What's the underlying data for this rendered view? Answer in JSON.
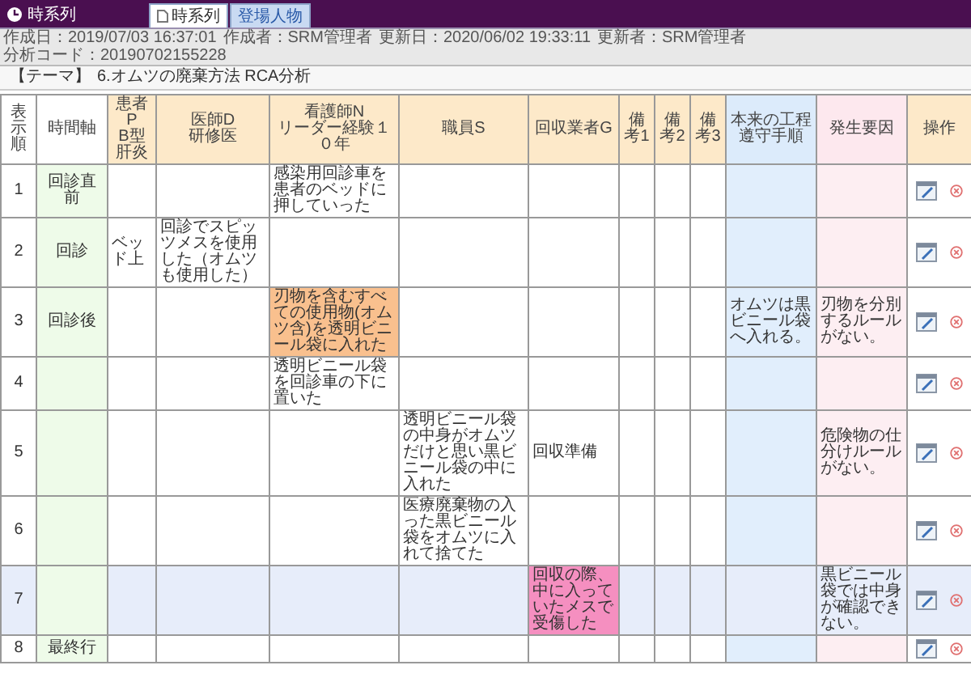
{
  "window": {
    "title": "時系列"
  },
  "tabs": [
    {
      "label": "時系列",
      "selected": true
    },
    {
      "label": "登場人物",
      "selected": false
    }
  ],
  "info": [
    "作成日：2019/07/03 16:37:01",
    "作成者：SRM管理者",
    "更新日：2020/06/02 19:33:11",
    "更新者：SRM管理者",
    "分析コード：20190702155228"
  ],
  "theme": {
    "label": "【テーマ】",
    "value": "6.オムツの廃棄方法 RCA分析"
  },
  "table": {
    "columns": [
      {
        "label": "表示順",
        "kind": "index"
      },
      {
        "label": "時間軸",
        "kind": "time"
      },
      {
        "label": "患者P\nB型肝炎",
        "kind": "person"
      },
      {
        "label": "医師D\n研修医",
        "kind": "person"
      },
      {
        "label": "看護師N\nリーダー経験１０年",
        "kind": "person"
      },
      {
        "label": "職員S",
        "kind": "person"
      },
      {
        "label": "回収業者G",
        "kind": "person"
      },
      {
        "label": "備考1",
        "kind": "note"
      },
      {
        "label": "備考2",
        "kind": "note"
      },
      {
        "label": "備考3",
        "kind": "note"
      },
      {
        "label": "本来の工程遵守手順",
        "kind": "standard"
      },
      {
        "label": "発生要因",
        "kind": "cause"
      },
      {
        "label": "操作",
        "kind": "action"
      }
    ],
    "rows": [
      {
        "order": "1",
        "time": "回診直前",
        "highlighted": false,
        "nurse": {
          "text": "感染用回診車を患者のベッドに押していった"
        }
      },
      {
        "order": "2",
        "time": "回診",
        "highlighted": false,
        "patient": {
          "text": "ベッド上"
        },
        "doctor": {
          "text": "回診でスピッツメスを使用した（オムツも使用した）"
        }
      },
      {
        "order": "3",
        "time": "回診後",
        "highlighted": false,
        "nurse": {
          "text": "刃物を含むすべての使用物(オムツ含)を透明ビニール袋に入れた",
          "color": "#f9c08e"
        },
        "standard": {
          "text": "オムツは黒ビニール袋へ入れる。"
        },
        "cause": {
          "text": "刃物を分別するルールがない。"
        }
      },
      {
        "order": "4",
        "highlighted": false,
        "nurse": {
          "text": "透明ビニール袋を回診車の下に置いた"
        }
      },
      {
        "order": "5",
        "highlighted": false,
        "staff": {
          "text": "透明ビニール袋の中身がオムツだけと思い黒ビニール袋の中に入れた"
        },
        "collector": {
          "text": "回収準備"
        },
        "cause": {
          "text": "危険物の仕分けルールがない。"
        }
      },
      {
        "order": "6",
        "highlighted": false,
        "staff": {
          "text": "医療廃棄物の入った黒ビニール袋をオムツに入れて捨てた"
        }
      },
      {
        "order": "7",
        "highlighted": true,
        "collector": {
          "text": "回収の際、中に入っていたメスで受傷した",
          "color": "#f58fc0"
        },
        "cause": {
          "text": "黒ビニール袋では中身が確認できない。"
        }
      },
      {
        "order": "8",
        "time": "最終行",
        "highlighted": false
      }
    ]
  }
}
